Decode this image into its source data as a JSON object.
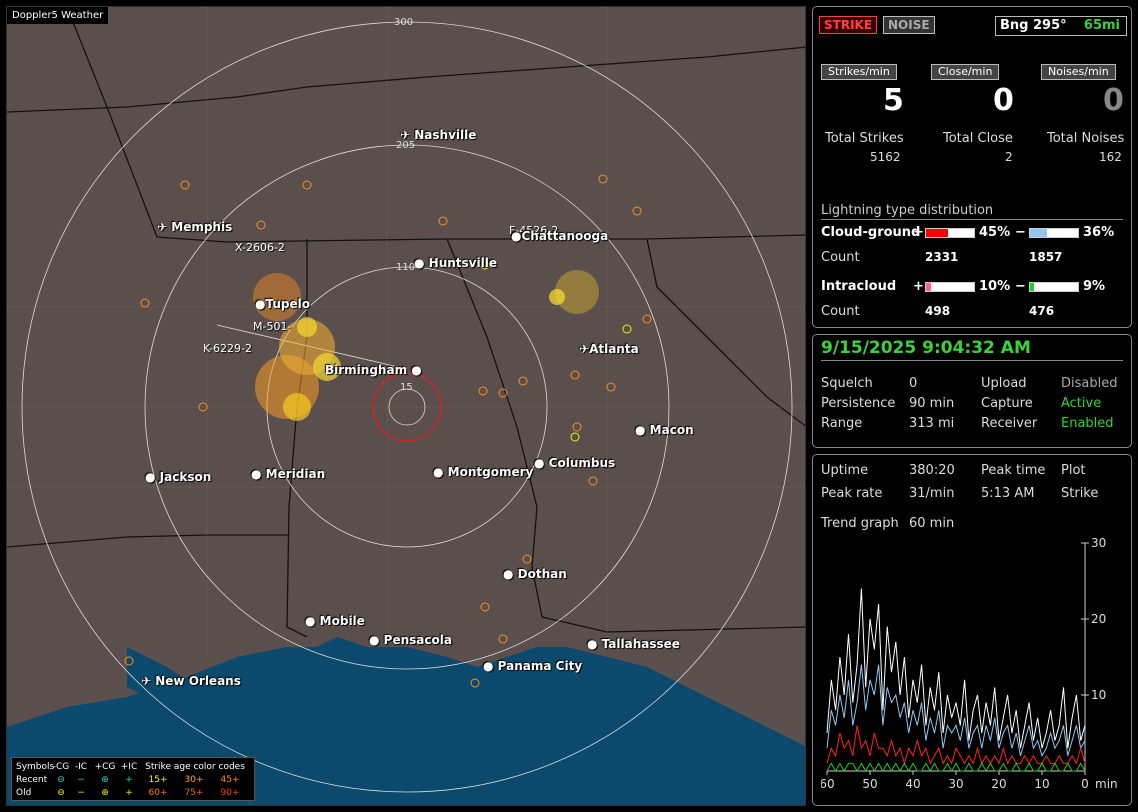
{
  "app_title": "Doppler5 Weather",
  "map": {
    "cities": [
      {
        "name": "Nashville",
        "icon": "airport-icon"
      },
      {
        "name": "Memphis",
        "icon": "airport-icon"
      },
      {
        "name": "Chattanooga",
        "icon": "dot-icon"
      },
      {
        "name": "Huntsville",
        "icon": "dot-icon"
      },
      {
        "name": "Tupelo",
        "icon": "dot-icon"
      },
      {
        "name": "Birmingham",
        "icon": "dot-icon"
      },
      {
        "name": "Atlanta",
        "icon": "airport-icon"
      },
      {
        "name": "Macon",
        "icon": "dot-icon"
      },
      {
        "name": "Jackson",
        "icon": "dot-icon"
      },
      {
        "name": "Meridian",
        "icon": "dot-icon"
      },
      {
        "name": "Montgomery",
        "icon": "dot-icon"
      },
      {
        "name": "Columbus",
        "icon": "dot-icon"
      },
      {
        "name": "Dothan",
        "icon": "dot-icon"
      },
      {
        "name": "Mobile",
        "icon": "dot-icon"
      },
      {
        "name": "Pensacola",
        "icon": "dot-icon"
      },
      {
        "name": "Tallahassee",
        "icon": "dot-icon"
      },
      {
        "name": "Panama City",
        "icon": "dot-icon"
      },
      {
        "name": "New Orleans",
        "icon": "airport-icon"
      }
    ],
    "ring_labels": [
      "300",
      "205",
      "110",
      "15"
    ],
    "storm_ids": [
      "X-2606-2",
      "M-501-",
      "K-6229-2",
      "F-4526-2"
    ]
  },
  "legend": {
    "header": [
      "Symbols",
      "-CG",
      "-IC",
      "+CG",
      "+IC",
      "Strike age color codes"
    ],
    "recent": {
      "label": "Recent",
      "symbols": [
        "⊖",
        "−",
        "⊕",
        "+"
      ],
      "ages": [
        "15+",
        "30+",
        "45+"
      ]
    },
    "old": {
      "label": "Old",
      "symbols": [
        "⊖",
        "−",
        "⊕",
        "+"
      ],
      "ages": [
        "60+",
        "75+",
        "90+"
      ]
    },
    "colors": {
      "recent": "#22d3d3",
      "old": "#f2f200",
      "a15": "#ffea00",
      "a30": "#ffb000",
      "a45": "#ff8c1a",
      "a60": "#ff7a1a",
      "a75": "#ff5a1a",
      "a90": "#ff3a1a"
    }
  },
  "panel1": {
    "strike_label": "STRIKE",
    "noise_label": "NOISE",
    "bearing": "Bng 295°",
    "range": "65mi",
    "strikes_min_label": "Strikes/min",
    "close_min_label": "Close/min",
    "noises_min_label": "Noises/min",
    "strikes_min": "5",
    "close_min": "0",
    "noises_min": "0",
    "total_strikes_label": "Total Strikes",
    "total_close_label": "Total Close",
    "total_noises_label": "Total Noises",
    "total_strikes": "5162",
    "total_close": "2",
    "total_noises": "162",
    "distribution_title": "Lightning type distribution",
    "cloud_ground_label": "Cloud-ground",
    "intracloud_label": "Intracloud",
    "count_label": "Count",
    "cg_pos_pct": "45%",
    "cg_neg_pct": "36%",
    "cg_pos_count": "2331",
    "cg_neg_count": "1857",
    "ic_pos_pct": "10%",
    "ic_neg_pct": "9%",
    "ic_pos_count": "498",
    "ic_neg_count": "476",
    "plus": "+",
    "minus": "−",
    "cg_pos_frac": 0.45,
    "cg_neg_frac": 0.36,
    "ic_pos_frac": 0.1,
    "ic_neg_frac": 0.09,
    "colors": {
      "cg_pos": "#ff0000",
      "cg_neg": "#8ec8f0",
      "ic_pos": "#ff5fa0",
      "ic_neg": "#22cc22"
    }
  },
  "panel2": {
    "datetime": "9/15/2025 9:04:32 AM",
    "squelch_label": "Squelch",
    "squelch": "0",
    "persistence_label": "Persistence",
    "persistence": "90 min",
    "range_label": "Range",
    "range": "313 mi",
    "upload_label": "Upload",
    "upload": "Disabled",
    "capture_label": "Capture",
    "capture": "Active",
    "receiver_label": "Receiver",
    "receiver": "Enabled"
  },
  "panel3": {
    "uptime_label": "Uptime",
    "uptime": "380:20",
    "peak_time_label": "Peak time",
    "peak_time": "5:13 AM",
    "plot_label": "Plot",
    "plot": "Strike",
    "peak_rate_label": "Peak rate",
    "peak_rate": "31/min",
    "trend_label": "Trend graph",
    "trend": "60 min",
    "x_unit": "min"
  },
  "chart_data": {
    "type": "line",
    "xlabel": "min",
    "x_ticks": [
      "60",
      "50",
      "40",
      "30",
      "20",
      "10",
      "0"
    ],
    "y_ticks": [
      "30",
      "20",
      "10"
    ],
    "ylim": [
      0,
      30
    ],
    "xlim": [
      60,
      0
    ],
    "x": [
      60,
      59,
      58,
      57,
      56,
      55,
      54,
      53,
      52,
      51,
      50,
      49,
      48,
      47,
      46,
      45,
      44,
      43,
      42,
      41,
      40,
      39,
      38,
      37,
      36,
      35,
      34,
      33,
      32,
      31,
      30,
      29,
      28,
      27,
      26,
      25,
      24,
      23,
      22,
      21,
      20,
      19,
      18,
      17,
      16,
      15,
      14,
      13,
      12,
      11,
      10,
      9,
      8,
      7,
      6,
      5,
      4,
      3,
      2,
      1,
      0
    ],
    "series": [
      {
        "color": "#ffffff",
        "values": [
          5,
          12,
          8,
          15,
          10,
          18,
          9,
          14,
          24,
          11,
          20,
          16,
          22,
          8,
          19,
          13,
          17,
          10,
          15,
          7,
          12,
          9,
          14,
          6,
          11,
          8,
          13,
          5,
          10,
          7,
          9,
          6,
          12,
          4,
          8,
          10,
          5,
          9,
          6,
          11,
          4,
          7,
          10,
          5,
          8,
          3,
          6,
          9,
          4,
          7,
          3,
          5,
          8,
          4,
          6,
          11,
          3,
          7,
          10,
          4,
          6
        ]
      },
      {
        "color": "#8ec8f0",
        "values": [
          3,
          8,
          6,
          10,
          7,
          12,
          6,
          9,
          14,
          8,
          12,
          10,
          14,
          6,
          11,
          9,
          10,
          7,
          9,
          5,
          8,
          6,
          9,
          4,
          7,
          5,
          8,
          3,
          6,
          5,
          6,
          4,
          7,
          3,
          5,
          6,
          3,
          6,
          4,
          7,
          3,
          5,
          6,
          3,
          5,
          2,
          4,
          6,
          3,
          4,
          2,
          3,
          5,
          3,
          4,
          6,
          2,
          4,
          6,
          3,
          4
        ]
      },
      {
        "color": "#ff2020",
        "values": [
          1,
          3,
          2,
          5,
          3,
          4,
          2,
          6,
          3,
          4,
          2,
          5,
          3,
          3,
          2,
          4,
          2,
          3,
          1,
          3,
          2,
          4,
          2,
          3,
          1,
          2,
          3,
          1,
          2,
          1,
          3,
          2,
          1,
          2,
          1,
          3,
          1,
          2,
          1,
          2,
          1,
          3,
          1,
          2,
          1,
          1,
          2,
          1,
          2,
          1,
          1,
          2,
          1,
          1,
          2,
          1,
          1,
          2,
          1,
          3,
          1
        ]
      },
      {
        "color": "#22cc22",
        "values": [
          0,
          1,
          0,
          1,
          0,
          1,
          1,
          0,
          1,
          0,
          1,
          0,
          1,
          0,
          1,
          0,
          1,
          0,
          1,
          0,
          1,
          0,
          0,
          1,
          0,
          1,
          0,
          0,
          1,
          0,
          1,
          0,
          0,
          1,
          0,
          0,
          1,
          0,
          1,
          0,
          0,
          1,
          0,
          0,
          1,
          0,
          0,
          1,
          0,
          0,
          1,
          0,
          0,
          1,
          0,
          0,
          1,
          0,
          0,
          1,
          0
        ]
      }
    ]
  }
}
